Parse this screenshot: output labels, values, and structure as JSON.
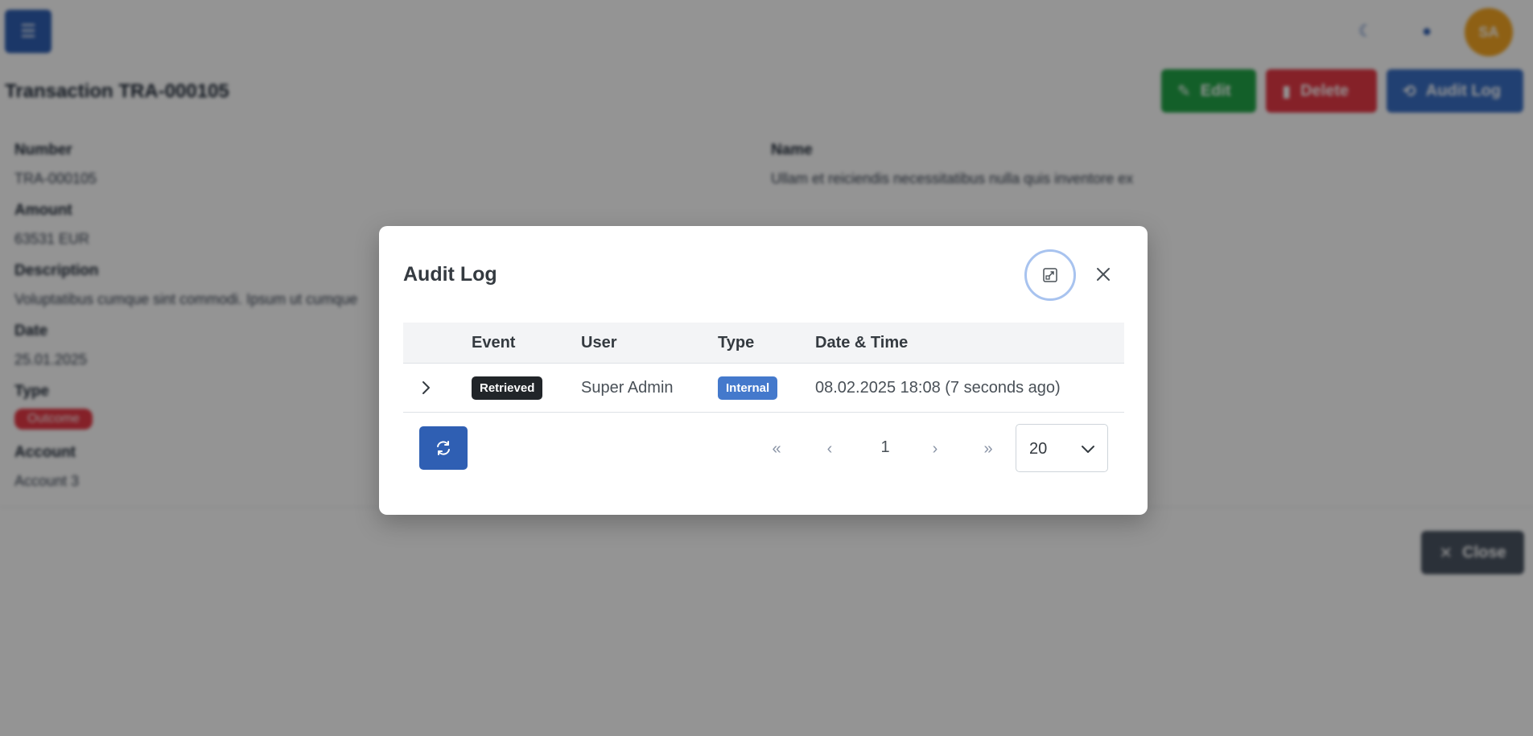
{
  "background": {
    "menu_icon": "menu-icon",
    "avatar_initials": "SA",
    "title": "Transaction TRA-000105",
    "actions": {
      "edit": "Edit",
      "delete": "Delete",
      "audit_log": "Audit Log"
    },
    "fields": {
      "number_label": "Number",
      "number_value": "TRA-000105",
      "name_label": "Name",
      "name_value": "Ullam et reiciendis necessitatibus nulla quis inventore ex",
      "amount_label": "Amount",
      "amount_value": "63531 EUR",
      "description_label": "Description",
      "description_value": "Voluptatibus cumque sint commodi. Ipsum ut cumque",
      "date_label": "Date",
      "date_value": "25.01.2025",
      "type_label": "Type",
      "type_value": "Outcome",
      "account_label": "Account",
      "account_value": "Account 3"
    },
    "close_button": "Close"
  },
  "modal": {
    "title": "Audit Log",
    "columns": {
      "event": "Event",
      "user": "User",
      "type": "Type",
      "datetime": "Date & Time"
    },
    "rows": [
      {
        "event": "Retrieved",
        "user": "Super Admin",
        "type": "Internal",
        "datetime": "08.02.2025 18:08 (7 seconds ago)"
      }
    ],
    "pagination": {
      "first": "«",
      "prev": "‹",
      "page": "1",
      "next": "›",
      "last": "»"
    },
    "page_size": "20"
  },
  "colors": {
    "primary": "#2f5fb3",
    "success": "#22a447",
    "danger": "#e63946",
    "dark_badge": "#212529",
    "info_badge": "#4479cc"
  }
}
